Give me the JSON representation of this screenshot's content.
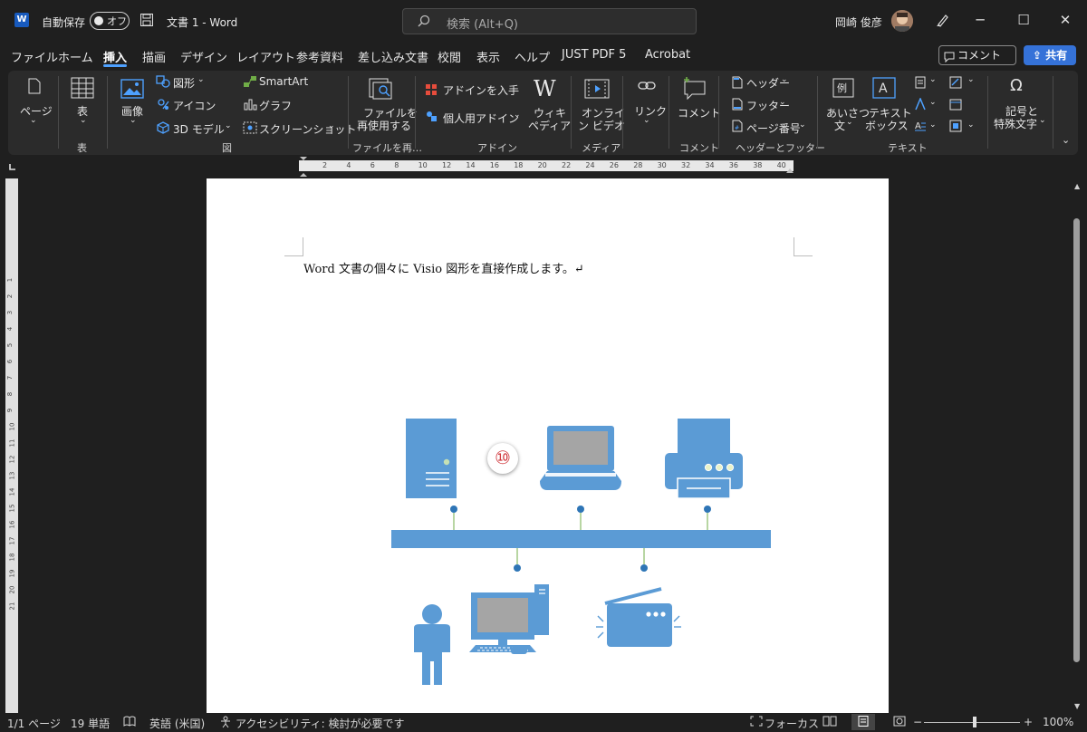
{
  "titlebar": {
    "autosave_label": "自動保存",
    "autosave_state": "オフ",
    "doc_title": "文書 1  -  Word",
    "search_placeholder": "検索 (Alt+Q)",
    "user_name": "岡崎 俊彦"
  },
  "menu": {
    "items": [
      "ファイル",
      "ホーム",
      "挿入",
      "描画",
      "デザイン",
      "レイアウト",
      "参考資料",
      "差し込み文書",
      "校閲",
      "表示",
      "ヘルプ",
      "JUST PDF 5",
      "Acrobat"
    ],
    "active": "挿入",
    "comment_label": "コメント",
    "share_label": "共有"
  },
  "ribbon": {
    "page_label": "ページ",
    "table_label": "表",
    "image_label": "画像",
    "shapes_label": "図形",
    "icons_label": "アイコン",
    "model3d_label": "3D モデル",
    "smartart_label": "SmartArt",
    "chart_label": "グラフ",
    "screenshot_label": "スクリーンショット",
    "reuse_label_1": "ファイルを",
    "reuse_label_2": "再使用する",
    "addin_get_label": "アドインを入手",
    "addin_personal_label": "個人用アドイン",
    "wiki_label_1": "ウィキ",
    "wiki_label_2": "ペディア",
    "video_label_1": "オンライ",
    "video_label_2": "ン ビデオ",
    "link_label": "リンク",
    "comment_label": "コメント",
    "header_label": "ヘッダー",
    "footer_label": "フッター",
    "pagenum_label": "ページ番号",
    "greeting_label_1": "あいさつ",
    "greeting_label_2": "文",
    "textbox_label_1": "テキスト",
    "textbox_label_2": "ボックス",
    "symbol_label_1": "記号と",
    "symbol_label_2": "特殊文字",
    "group_labels": {
      "table": "表",
      "illustrations": "図",
      "reuse": "ファイルを再…",
      "addins": "アドイン",
      "media": "メディア",
      "comments": "コメント",
      "header_footer": "ヘッダーとフッター",
      "text": "テキスト"
    }
  },
  "ruler": {
    "ticks": [
      "2",
      "4",
      "6",
      "8",
      "10",
      "12",
      "14",
      "16",
      "18",
      "20",
      "22",
      "24",
      "26",
      "28",
      "30",
      "32",
      "34",
      "36",
      "38",
      "40"
    ],
    "vticks": [
      "1",
      "2",
      "3",
      "4",
      "5",
      "6",
      "7",
      "8",
      "9",
      "10",
      "11",
      "12",
      "13",
      "14",
      "15",
      "16",
      "17",
      "18",
      "19",
      "20",
      "21"
    ]
  },
  "document": {
    "line1": "Word 文書の個々に Visio 図形を直接作成します。↵",
    "callout_number": "⑩"
  },
  "statusbar": {
    "page": "1/1 ページ",
    "words": "19 単語",
    "language": "英語 (米国)",
    "accessibility": "アクセシビリティ: 検討が必要です",
    "focus": "フォーカス",
    "zoom": "100%"
  },
  "colors": {
    "accent": "#4ea1ff",
    "share": "#3572d8",
    "visio_blue": "#5b9bd5",
    "connector_green": "#70ad47"
  }
}
